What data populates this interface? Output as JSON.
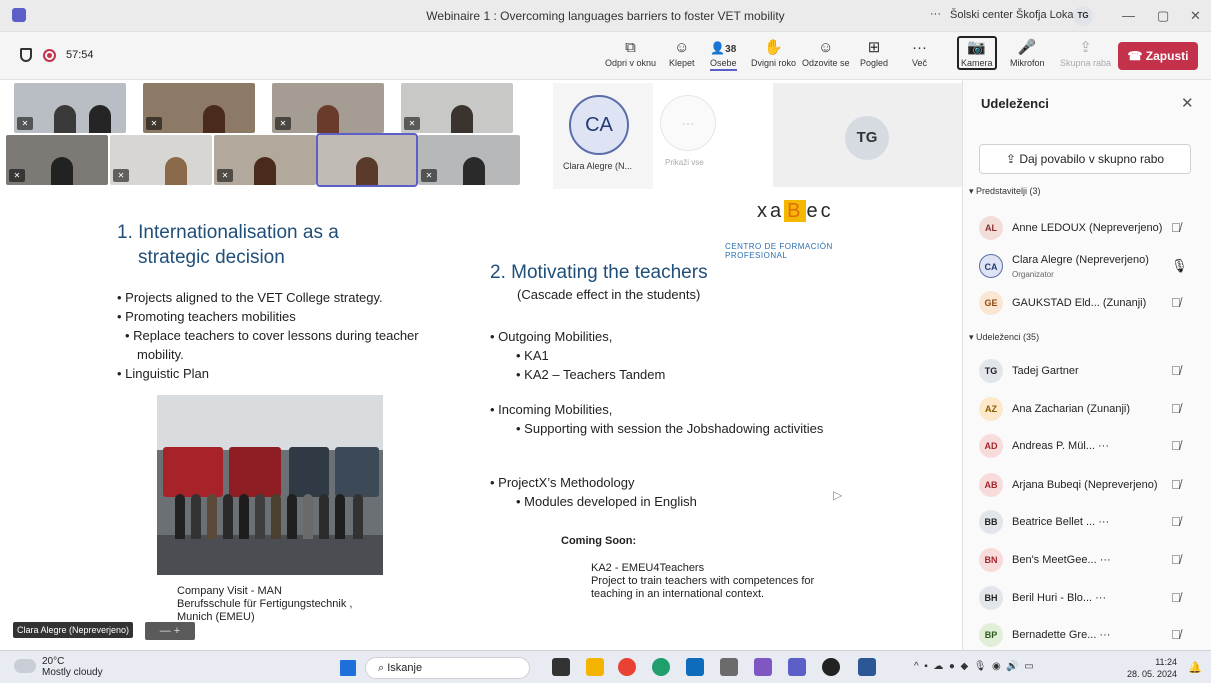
{
  "window": {
    "title": "Webinaire 1 : Overcoming languages barriers to foster VET mobility",
    "more": "···",
    "org": "Šolski center Škofja Loka",
    "org_initials": "TG",
    "min": "—",
    "restore": "▢",
    "close": "✕"
  },
  "meeting": {
    "timer": "57:54",
    "toolbar": [
      {
        "label": "Odpri v oknu",
        "icon": "⧉"
      },
      {
        "label": "Klepet",
        "icon": "☺"
      },
      {
        "label": "Osebe",
        "icon": "👤",
        "count": "38"
      },
      {
        "label": "Dvigni roko",
        "icon": "✋"
      },
      {
        "label": "Odzovite se",
        "icon": "☺"
      },
      {
        "label": "Pogled",
        "icon": "⊞"
      },
      {
        "label": "Več",
        "icon": "···"
      },
      {
        "label": "Kamera",
        "icon": "📷"
      },
      {
        "label": "Mikrofon",
        "icon": "🎤"
      },
      {
        "label": "Skupna raba",
        "icon": "⇪"
      }
    ],
    "leave_label": "Zapusti"
  },
  "stage": {
    "ca_initials": "CA",
    "ca_name": "Clara Alegre (N...",
    "show_all": "Prikaži vse",
    "show_all_icon": "···",
    "tg_initials": "TG",
    "speaker_pill": "Clara Alegre (Nepreverjeno)",
    "pill_ctrl": "—  +"
  },
  "slide": {
    "logo_x": "xa",
    "logo_b": "B",
    "logo_ec": "ec",
    "logo_sub": "CENTRO DE FORMACIÓN PROFESIONAL",
    "heading1_line1": "1.  Internationalisation as a",
    "heading1_line2": "strategic decision",
    "left_bullets": [
      "Projects aligned to the VET College strategy.",
      "Promoting teachers mobilities",
      "Replace teachers to cover lessons during teacher mobility.",
      "Linguistic Plan"
    ],
    "heading2": "2. Motivating the teachers",
    "heading2_sub": "(Cascade effect in the students)",
    "right_items": [
      {
        "label": "Outgoing Mobilities,",
        "subs": [
          "KA1",
          "KA2 – Teachers Tandem"
        ]
      },
      {
        "label": "Incoming Mobilities,",
        "subs": [
          "Supporting with session the Jobshadowing activities"
        ]
      },
      {
        "label": "ProjectX’s Methodology",
        "subs": [
          "Modules developed in English"
        ]
      }
    ],
    "caption_1": "Company Visit - MAN",
    "caption_2": "Berufsschule für Fertigungstechnik ,",
    "caption_3": "Munich (EMEU)",
    "coming_soon": "Coming Soon:",
    "ka2_title": "KA2 - EMEU4Teachers",
    "ka2_desc_1": "Project to train teachers with competences for",
    "ka2_desc_2": "teaching in an international context."
  },
  "panel": {
    "title": "Udeleženci",
    "close_icon": "✕",
    "invite_label": "Daj povabilo v skupno rabo",
    "presenters_header": "Predstavitelji (3)",
    "attendees_header": "Udeleženci (35)",
    "presenters": [
      {
        "initials": "AL",
        "name": "Anne LEDOUX (Nepreverjeno)",
        "role": "",
        "color": "#f3ddd9"
      },
      {
        "initials": "CA",
        "name": "Clara Alegre (Nepreverjeno)",
        "role": "Organizator",
        "color": "#dfe4f5"
      },
      {
        "initials": "GE",
        "name": "GAUKSTAD Eld... (Zunanji)",
        "role": "",
        "color": "#fbe6d4"
      }
    ],
    "attendees": [
      {
        "initials": "TG",
        "name": "Tadej Gartner",
        "color": "#e2e5ea"
      },
      {
        "initials": "AZ",
        "name": "Ana Zacharian (Zunanji)",
        "color": "#fde9c9"
      },
      {
        "initials": "AD",
        "name": "Andreas P. Mül... ···",
        "color": "#f8dcdc"
      },
      {
        "initials": "AB",
        "name": "Arjana Bubeqi (Nepreverjeno)",
        "color": "#f8dcdc"
      },
      {
        "initials": "BB",
        "name": "Beatrice Bellet ... ···",
        "color": "#e2e5ea"
      },
      {
        "initials": "BN",
        "name": "Ben's MeetGee... ···",
        "color": "#f8dcdc"
      },
      {
        "initials": "BH",
        "name": "Beril Huri - Blo... ···",
        "color": "#e2e5ea"
      },
      {
        "initials": "BP",
        "name": "Bernadette Gre... ···",
        "color": "#e1efd9"
      }
    ]
  },
  "taskbar": {
    "temp": "20°C",
    "weather": "Mostly cloudy",
    "search_placeholder": "Iskanje",
    "time": "11:24",
    "date": "28. 05. 2024"
  }
}
